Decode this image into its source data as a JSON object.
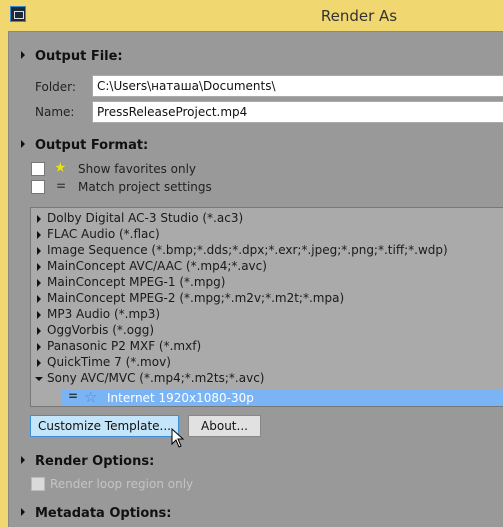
{
  "window": {
    "title": "Render As"
  },
  "output_file": {
    "heading": "Output File:",
    "folder_label": "Folder:",
    "folder_value": "C:\\Users\\наташа\\Documents\\",
    "name_label": "Name:",
    "name_value": "PressReleaseProject.mp4"
  },
  "output_format": {
    "heading": "Output Format:",
    "show_favorites": "Show favorites only",
    "match_project": "Match project settings",
    "formats": [
      "Dolby Digital AC-3 Studio (*.ac3)",
      "FLAC Audio (*.flac)",
      "Image Sequence (*.bmp;*.dds;*.dpx;*.exr;*.jpeg;*.png;*.tiff;*.wdp)",
      "MainConcept AVC/AAC (*.mp4;*.avc)",
      "MainConcept MPEG-1 (*.mpg)",
      "MainConcept MPEG-2 (*.mpg;*.m2v;*.m2t;*.mpa)",
      "MP3 Audio (*.mp3)",
      "OggVorbis (*.ogg)",
      "Panasonic P2 MXF (*.mxf)",
      "QuickTime 7 (*.mov)",
      "Sony AVC/MVC (*.mp4;*.m2ts;*.avc)"
    ],
    "selected_template": "Internet 1920x1080-30p",
    "customize_button": "Customize Template...",
    "about_button": "About..."
  },
  "render_options": {
    "heading": "Render Options:",
    "loop_region": "Render loop region only"
  },
  "metadata_options": {
    "heading": "Metadata Options:"
  },
  "colors": {
    "titlebar": "#f0d770",
    "background": "#999999",
    "selection": "#7ab4f5"
  }
}
